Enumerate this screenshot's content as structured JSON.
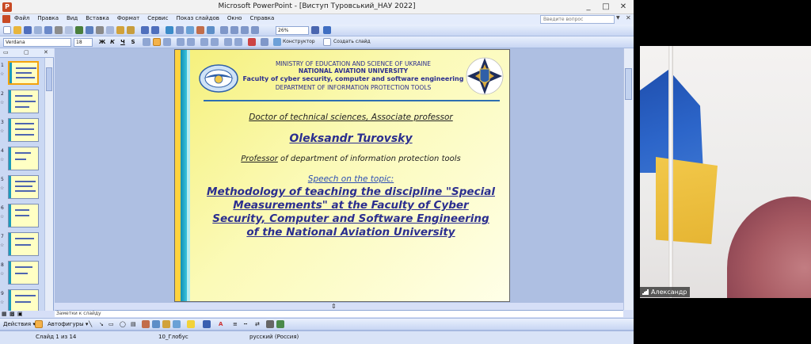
{
  "window": {
    "title": "Microsoft PowerPoint - [Виступ Туровський_НАУ 2022]",
    "controls": [
      "_",
      "□",
      "✕"
    ]
  },
  "menu": {
    "items": [
      "Файл",
      "Правка",
      "Вид",
      "Вставка",
      "Формат",
      "Сервис",
      "Показ слайдов",
      "Окно",
      "Справка"
    ],
    "help_placeholder": "Введите вопрос"
  },
  "toolbar": {
    "zoom": "26%",
    "font_name": "Verdana",
    "font_size": "18",
    "bold": "Ж",
    "italic": "К",
    "underline": "Ч",
    "shadow": "S",
    "designer": "Конструктор",
    "new_slide": "Создать слайд"
  },
  "outline": {
    "slides": [
      "1",
      "2",
      "3",
      "4",
      "5",
      "6",
      "7",
      "8",
      "9"
    ]
  },
  "slide": {
    "ministry": "MINISTRY OF EDUCATION AND SCIENCE OF UKRAINE",
    "university": "NATIONAL AVIATION UNIVERSITY",
    "faculty": "Faculty of cyber security, computer and software engineering",
    "department": "DEPARTMENT OF INFORMATION PROTECTION TOOLS",
    "degree": "Doctor of technical sciences, Associate professor",
    "name": "Oleksandr Turovsky",
    "professor_word": "Professor",
    "professor_rest": " of  department of information protection tools",
    "speech": "Speech on the topic:",
    "topic": "Methodology of teaching the discipline \"Special Measurements\" at the Faculty of Cyber Security, Computer and Software Engineering of the National Aviation University"
  },
  "notes": {
    "placeholder": "Заметки к слайду"
  },
  "drawing": {
    "actions": "Действия ▾",
    "autoshapes": "Автофигуры ▾"
  },
  "status": {
    "slide": "Слайд 1 из 14",
    "design": "10_Глобус",
    "language": "русский (Россия)"
  },
  "video": {
    "participant": "Александр"
  },
  "colors": {
    "slide_title_blue": "#2b2e8f",
    "slide_bg_yellow": "#fbfab7",
    "accent_cyan": "#0e8fb4",
    "flag_blue": "#2c65c9",
    "flag_yellow": "#f2c84a"
  }
}
